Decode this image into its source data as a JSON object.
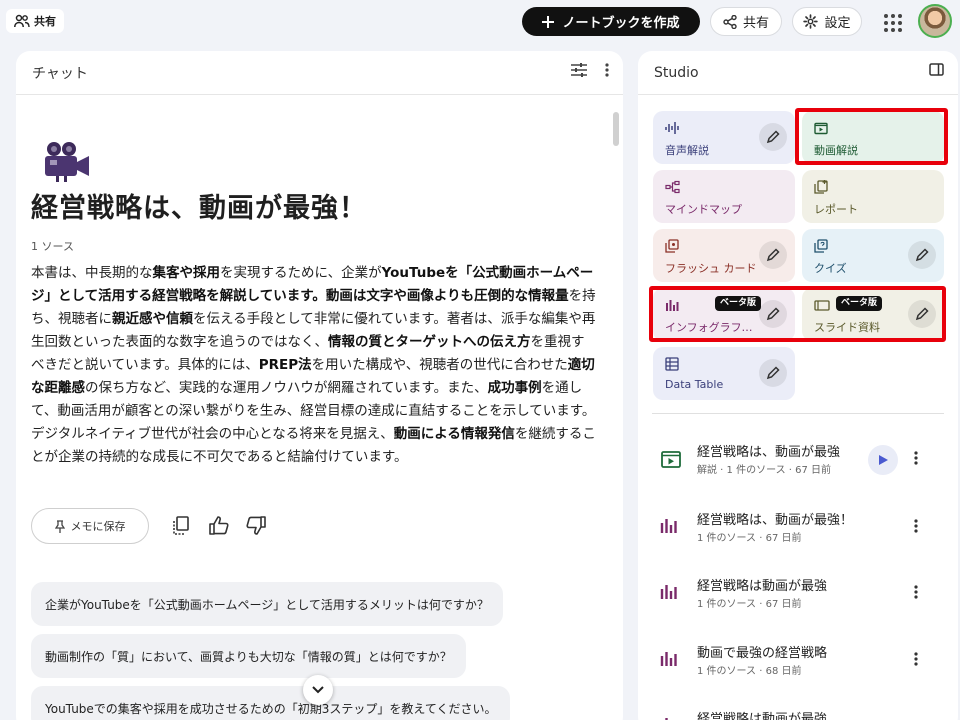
{
  "topbar": {
    "share_chip": "共有",
    "new_notebook": "ノートブックを作成",
    "share": "共有",
    "settings": "設定"
  },
  "chat": {
    "header": "チャット",
    "title": "経営戦略は、動画が最強！",
    "source_count": "1 ソース",
    "summary": [
      {
        "t": "本書は、中長期的な",
        "b": false
      },
      {
        "t": "集客や採用",
        "b": true
      },
      {
        "t": "を実現するために、企業が",
        "b": false
      },
      {
        "t": "YouTubeを「公式動画ホームページ」として活用する経営戦略を解説しています。動画は文字や画像よりも圧倒的な情報量",
        "b": true
      },
      {
        "t": "を持ち、視聴者に",
        "b": false
      },
      {
        "t": "親近感や信頼",
        "b": true
      },
      {
        "t": "を伝える手段として非常に優れています。著者は、派手な編集や再生回数といった表面的な数字を追うのではなく、",
        "b": false
      },
      {
        "t": "情報の質とターゲットへの伝え方",
        "b": true
      },
      {
        "t": "を重視すべきだと説いています。具体的には、",
        "b": false
      },
      {
        "t": "PREP法",
        "b": true
      },
      {
        "t": "を用いた構成や、視聴者の世代に合わせた",
        "b": false
      },
      {
        "t": "適切な距離感",
        "b": true
      },
      {
        "t": "の保ち方など、実践的な運用ノウハウが網羅されています。また、",
        "b": false
      },
      {
        "t": "成功事例",
        "b": true
      },
      {
        "t": "を通して、動画活用が顧客との深い繋がりを生み、経営目標の達成に直結することを示しています。デジタルネイティブ世代が社会の中心となる将来を見据え、",
        "b": false
      },
      {
        "t": "動画による情報発信",
        "b": true
      },
      {
        "t": "を継続することが企業の持続的な成長に不可欠であると結論付けています。",
        "b": false
      }
    ],
    "save_memo": "メモに保存",
    "suggestions": [
      "企業がYouTubeを「公式動画ホームページ」として活用するメリットは何ですか？",
      "動画制作の「質」において、画質よりも大切な「情報の質」とは何ですか？",
      "YouTubeでの集客や採用を成功させるための「初期3ステップ」を教えてください。"
    ]
  },
  "studio": {
    "header": "Studio",
    "tiles": [
      {
        "label": "音声解説",
        "bg": "#ebedf8",
        "fg": "#3a3f7a"
      },
      {
        "label": "動画解説",
        "bg": "#e5f2ea",
        "fg": "#1e5b33"
      },
      {
        "label": "マインドマップ",
        "bg": "#f3ebf2",
        "fg": "#7a2a6a"
      },
      {
        "label": "レポート",
        "bg": "#f1f0e6",
        "fg": "#5b5a2c"
      },
      {
        "label": "フラッシュ カード",
        "bg": "#f7ecea",
        "fg": "#8a2f26"
      },
      {
        "label": "クイズ",
        "bg": "#e6f1f7",
        "fg": "#1f4f6b"
      },
      {
        "label": "インフォグラフィック",
        "bg": "#f3ebf2",
        "fg": "#7a2a6a",
        "beta": "ベータ版"
      },
      {
        "label": "スライド資料",
        "bg": "#f1f0e6",
        "fg": "#5b5a2c",
        "beta": "ベータ版"
      },
      {
        "label": "Data Table",
        "bg": "#ebedf8",
        "fg": "#3a3f7a"
      }
    ],
    "items": [
      {
        "title": "経営戦略は、動画が最強",
        "sub": "解説 · 1 件のソース · 67 日前",
        "kind": "video"
      },
      {
        "title": "経営戦略は、動画が最強！",
        "sub": "1 件のソース · 67 日前",
        "kind": "infographic"
      },
      {
        "title": "経営戦略は動画が最強",
        "sub": "1 件のソース · 67 日前",
        "kind": "infographic"
      },
      {
        "title": "動画で最強の経営戦略",
        "sub": "1 件のソース · 68 日前",
        "kind": "infographic"
      },
      {
        "title": "経営戦略は動画が最強",
        "sub": "",
        "kind": "infographic"
      }
    ]
  }
}
